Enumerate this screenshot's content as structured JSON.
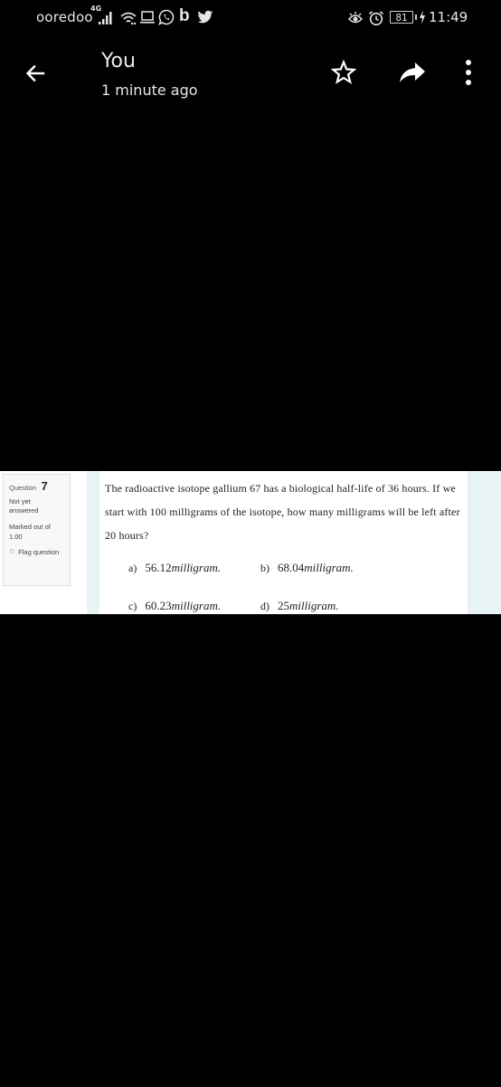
{
  "status_bar": {
    "carrier": "ooredoo",
    "network_type": "4G",
    "app_icons": [
      "signal-icon",
      "wifi-icon",
      "laptop-icon",
      "whatsapp-icon",
      "b-app-icon",
      "twitter-icon"
    ],
    "b_app_glyph": "b",
    "right_icons": [
      "eye-icon",
      "alarm-icon",
      "battery-icon",
      "charging-icon"
    ],
    "battery_level": "81",
    "time": "11:49"
  },
  "app_bar": {
    "title": "You",
    "subtitle": "1 minute ago",
    "actions": [
      "back",
      "star",
      "share",
      "more"
    ]
  },
  "image": {
    "info": {
      "question_label": "Question",
      "question_number": "7",
      "status_line1": "Not yet",
      "status_line2": "answered",
      "marked_line1": "Marked out of",
      "marked_line2": "1.00",
      "flag_label": "Flag question",
      "flag_glyph": "⚐"
    },
    "question_text": "The radioactive isotope gallium 67 has a biological half-life of 36 hours.  If we start with 100 milligrams of the isotope, how many milligrams will be left after 20 hours?",
    "options": [
      {
        "letter": "a)",
        "value": "56.12",
        "unit": "milligram."
      },
      {
        "letter": "b)",
        "value": "68.04",
        "unit": "milligram."
      },
      {
        "letter": "c)",
        "value": "60.23",
        "unit": "milligram."
      },
      {
        "letter": "d)",
        "value": "25",
        "unit": "milligram."
      }
    ]
  }
}
